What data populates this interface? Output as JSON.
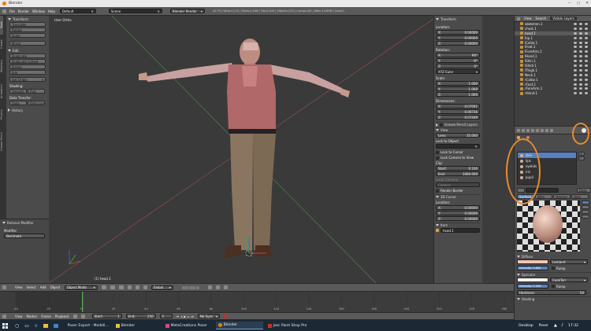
{
  "app": {
    "title": "Blender"
  },
  "top_menu": [
    "File",
    "Render",
    "Window",
    "Help"
  ],
  "layout_field": "Default",
  "scene_field": "Scene",
  "engine_field": "Blender Render",
  "stats": "v2.79 | Verts:2,115 | Faces:2,548 | Tris:5,544 | Objects:1/24 | Lamps:0/0 | Mem:14.80M | head.1",
  "toolshelf": {
    "tabs": [
      "Tools",
      "Create",
      "Relations",
      "Animation",
      "Physics",
      "Grease Pencil"
    ],
    "transform_header": "Transform",
    "transform_buttons": [
      "Translate",
      "Rotate",
      "Scale",
      "Mirror"
    ],
    "edit_header": "Edit",
    "edit_buttons": [
      "Duplicate",
      "Duplicate Linked",
      "Delete",
      "Join"
    ],
    "set_origin": "Set Origin",
    "shading_label": "Shading:",
    "smooth": "Smooth",
    "flat": "Flat",
    "data_transfer_label": "Data Transfer:",
    "data": "Data",
    "data_layout": "Data Layo",
    "history_header": "History",
    "operator_header": "Remove Modifier",
    "modifier_label": "Modifier",
    "modifier_value": "Decimate"
  },
  "viewport": {
    "view_label": "User Ortho",
    "object_label": "(1) head.1"
  },
  "npanel": {
    "transform_header": "Transform",
    "location_label": "Location:",
    "location": [
      {
        "axis": "X:",
        "value": "0.00000"
      },
      {
        "axis": "Y:",
        "value": "0.00000"
      },
      {
        "axis": "Z:",
        "value": "0.00000"
      }
    ],
    "rotation_label": "Rotation:",
    "rotation": [
      {
        "axis": "X:",
        "value": "90°"
      },
      {
        "axis": "Y:",
        "value": "-0°"
      },
      {
        "axis": "Z:",
        "value": "0°"
      }
    ],
    "rotation_mode": "XYZ Euler",
    "scale_label": "Scale:",
    "scale": [
      {
        "axis": "X:",
        "value": "1.000"
      },
      {
        "axis": "Y:",
        "value": "1.000"
      },
      {
        "axis": "Z:",
        "value": "1.000"
      }
    ],
    "dimensions_label": "Dimensions:",
    "dimensions": [
      {
        "axis": "X:",
        "value": "0.07001"
      },
      {
        "axis": "Y:",
        "value": "0.06736"
      },
      {
        "axis": "Z:",
        "value": "0.07449"
      }
    ],
    "grease_pencil_header": "Grease Pencil Layers",
    "view_header": "View",
    "lens_label": "Lens:",
    "lens_value": "35.000",
    "lock_to_object": "Lock to Object:",
    "lock_to_cursor": "Lock to Cursor",
    "lock_camera": "Lock Camera to View",
    "clip_label": "Clip:",
    "clip_start_label": "Start:",
    "clip_start": "0.100",
    "clip_end_label": "End:",
    "clip_end": "1000.000",
    "local_camera_label": "Local Camera:",
    "local_camera_value": "Camera",
    "render_border": "Render Border",
    "cursor_header": "3D Cursor",
    "cursor_location_label": "Location:",
    "cursor": [
      {
        "axis": "X:",
        "value": "0.00000"
      },
      {
        "axis": "Y:",
        "value": "0.00000"
      },
      {
        "axis": "Z:",
        "value": "0.00000"
      }
    ],
    "item_header": "Item",
    "item_name": "head.1"
  },
  "outliner": {
    "tabs": [
      "View",
      "Search",
      "Visible Layers"
    ],
    "items": [
      "abdomen.1",
      "chest.1",
      "head.1",
      "hip.1",
      "lCollar.1",
      "lFoot.1",
      "lForeArm.1",
      "lHand.1",
      "lShin.1",
      "lShldr.1",
      "lThigh.1",
      "Neck.1",
      "rCollar.1",
      "rFoot.1",
      "rForeArm.1",
      "rHand.1"
    ]
  },
  "materials": {
    "slots": [
      "skin",
      "lips",
      "eyelids",
      "iris",
      "pupil"
    ],
    "data_label": "Data",
    "subtabs": [
      "Surface",
      "Wire",
      "Volume",
      "Halo"
    ],
    "diffuse_header": "Diffuse",
    "diffuse_shader": "Lambert",
    "intensity_label": "Intensity: 0.800",
    "ramp": "Ramp",
    "specular_header": "Specular",
    "specular_shader": "CookTorr",
    "spec_intensity": "Intensity: 0.500",
    "hardness": "Hardness:",
    "hardness_value": "50",
    "shading_header": "Shading",
    "colors": {
      "diffuse": "#f1c6b4",
      "specular": "#ffffff",
      "highlight": "#e88a2e"
    }
  },
  "viewport_header": {
    "menus": [
      "View",
      "Select",
      "Add",
      "Object"
    ],
    "mode": "Object Mode",
    "orientation": "Global"
  },
  "timeline": {
    "menus": [
      "View",
      "Marker",
      "Frame",
      "Playback"
    ],
    "start_label": "Start:",
    "start_value": "1",
    "end_label": "End:",
    "end_value": "250",
    "current_frame": "1",
    "sync": "No Sync",
    "ticks": [
      "-40",
      "-20",
      "0",
      "20",
      "40",
      "60",
      "80",
      "100",
      "120",
      "140",
      "160",
      "180",
      "200",
      "220",
      "240",
      "260"
    ]
  },
  "taskbar": {
    "apps": [
      "Poser Export - Modell...",
      "Blender",
      "MetaCreations Poser",
      "Blender",
      "Jasc Paint Shop Pro"
    ],
    "desktop_label": "Desktop",
    "folder_label": "Poser",
    "clock": "17:32"
  }
}
